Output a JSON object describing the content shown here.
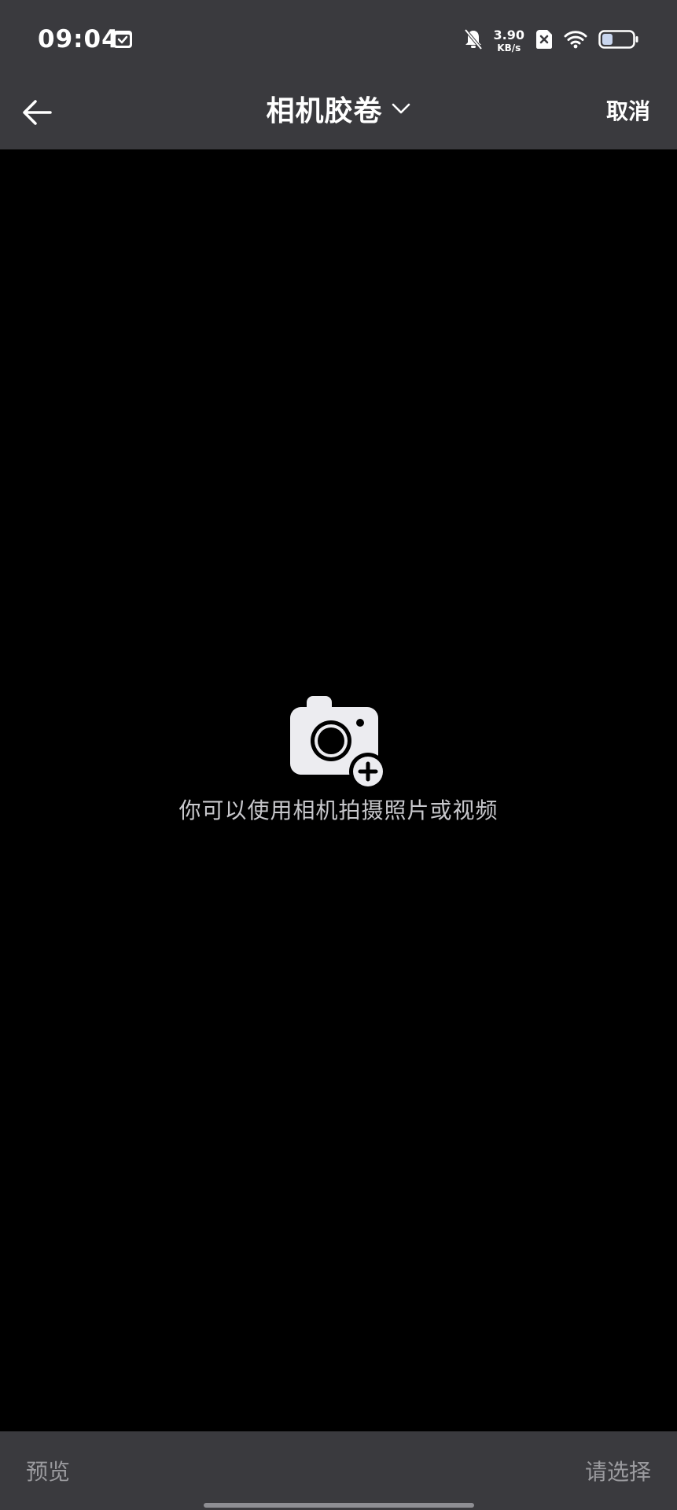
{
  "status_bar": {
    "time": "09:04",
    "net_speed_value": "3.90",
    "net_speed_unit": "KB/s",
    "icons": [
      "calendar-check-icon",
      "bell-muted-icon",
      "sim-off-icon",
      "wifi-icon",
      "battery-icon"
    ],
    "battery_level": 0.35
  },
  "header": {
    "back_icon": "arrow-left-icon",
    "title": "相机胶卷",
    "title_dropdown_icon": "chevron-down-icon",
    "cancel_label": "取消"
  },
  "empty_state": {
    "icon": "camera-add-icon",
    "message": "你可以使用相机拍摄照片或视频"
  },
  "footer": {
    "preview_label": "预览",
    "select_label": "请选择"
  },
  "colors": {
    "bar_background": "#3a3a3e",
    "content_background": "#000000",
    "text_primary": "#ffffff",
    "text_disabled": "#9a9a9e",
    "empty_text": "#c8c8cc",
    "icon_fill": "#ececf0"
  }
}
